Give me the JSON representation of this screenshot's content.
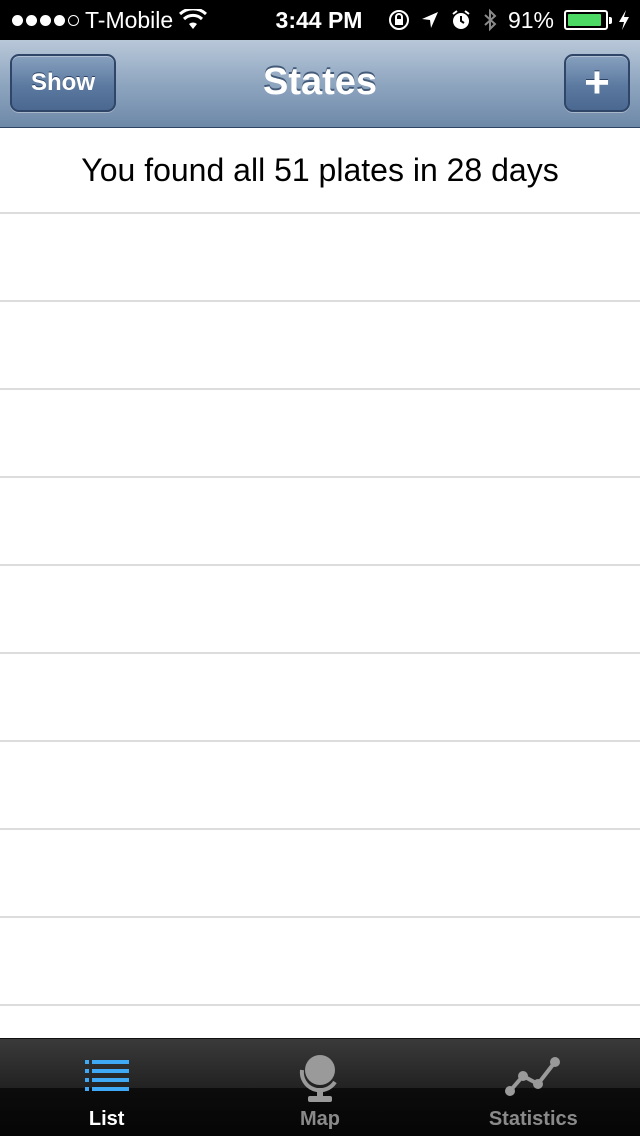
{
  "status_bar": {
    "carrier": "T-Mobile",
    "time": "3:44 PM",
    "battery_percent": "91%",
    "battery_level": 0.91,
    "signal_strength": 4,
    "icons": [
      "wifi-icon",
      "rotation-lock-icon",
      "location-icon",
      "alarm-icon",
      "bluetooth-icon",
      "charging-icon"
    ]
  },
  "nav": {
    "title": "States",
    "left_button": "Show",
    "right_button": "+"
  },
  "summary": {
    "text": "You found all 51 plates in 28 days"
  },
  "table": {
    "rows": [
      "",
      "",
      "",
      "",
      "",
      "",
      "",
      "",
      ""
    ]
  },
  "tabs": [
    {
      "label": "List",
      "icon": "list-icon",
      "active": true
    },
    {
      "label": "Map",
      "icon": "globe-icon",
      "active": false
    },
    {
      "label": "Statistics",
      "icon": "stats-icon",
      "active": false
    }
  ],
  "colors": {
    "nav_bar": "#8fa6c0",
    "battery": "#4cd964",
    "active_tab_icon": "#3fa9f5"
  }
}
